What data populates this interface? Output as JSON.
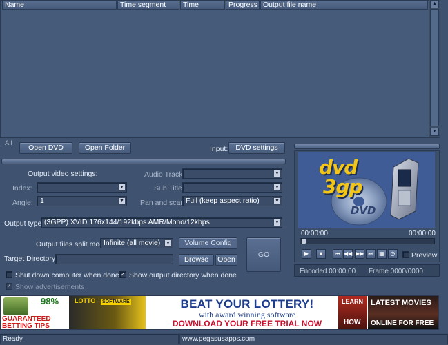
{
  "file_list": {
    "columns": [
      "Name",
      "Time segment",
      "Time",
      "Progress",
      "Output file name"
    ]
  },
  "source": {
    "all_label": "All",
    "open_dvd_label": "Open DVD",
    "open_folder_label": "Open Folder",
    "input_label": "Input:",
    "dvd_settings_label": "DVD settings"
  },
  "video_settings": {
    "header": "Output video settings:",
    "index_label": "Index:",
    "index_value": "",
    "angle_label": "Angle:",
    "angle_value": "1",
    "audio_track_label": "Audio Track:",
    "audio_track_value": "",
    "subtitle_label": "Sub Title:",
    "subtitle_value": "",
    "pan_scan_label": "Pan and scan:",
    "pan_scan_value": "Full (keep aspect ratio)"
  },
  "output": {
    "type_label": "Output type:",
    "type_value": "(3GPP) XVID 176x144/192kbps  AMR/Mono/12kbps",
    "split_label": "Output files split mode:",
    "split_value": "Infinite (all movie)",
    "volume_config_label": "Volume Config",
    "target_dir_label": "Target Directory:",
    "target_dir_value": "",
    "browse_label": "Browse",
    "open_label": "Open",
    "go_label": "GO",
    "shutdown_label": "Shut down computer when done",
    "shutdown_checked": false,
    "show_dir_label": "Show output directory when done",
    "show_dir_checked": true,
    "show_ads_label": "Show advertisements",
    "show_ads_checked": true
  },
  "preview": {
    "logo_line1": "dvd",
    "logo_line2": "3gp",
    "disc_label": "DVD",
    "time_start": "00:00:00",
    "time_end": "00:00:00",
    "seek_position": 0,
    "preview_label": "Preview",
    "preview_checked": false,
    "encoded_text": "Encoded 00:00:00",
    "frame_text": "Frame 0000/0000"
  },
  "ad": {
    "betting_pct": "98%",
    "betting_line1": "GUARANTEED",
    "betting_line2": "BETTING TIPS",
    "lottery_brand": "LOTTO",
    "lottery_software": "SOFTWARE",
    "lottery_headline": "BEAT YOUR LOTTERY!",
    "lottery_sub": "with award winning software",
    "lottery_cta": "DOWNLOAD YOUR FREE TRIAL NOW",
    "learn_line1": "LEARN",
    "learn_line2": "HOW",
    "movies_line1": "LATEST MOVIES",
    "movies_line2": "ONLINE FOR FREE"
  },
  "status": {
    "state": "Ready",
    "url": "www.pegasusapps.com"
  },
  "colors": {
    "background": "#3f5371",
    "panel": "#465b79",
    "lottery_red": "#c8102e",
    "lottery_blue": "#1d3c8c"
  }
}
